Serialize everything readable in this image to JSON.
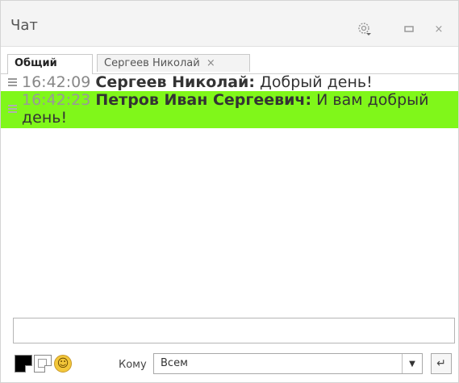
{
  "window": {
    "title": "Чат",
    "icons": {
      "settings": "gear-icon",
      "minimize": "minimize-icon",
      "close": "close-icon"
    }
  },
  "tabs": [
    {
      "label": "Общий",
      "active": true
    },
    {
      "label": "Сергеев Николай",
      "active": false,
      "close": "×"
    }
  ],
  "messages": [
    {
      "time": "16:42:09",
      "author": "Сергеев Николай:",
      "text": "Добрый день!",
      "highlighted": false
    },
    {
      "time": "16:42:23",
      "author": "Петров Иван  Сергеевич:",
      "text": "И вам добрый день!",
      "highlighted": true,
      "highlight_color": "#80f71a"
    }
  ],
  "composer": {
    "input_value": "",
    "to_label": "Кому",
    "recipient": "Всем",
    "tools": [
      "text-color-icon",
      "background-color-icon",
      "smiley-icon"
    ],
    "send_icon": "enter-icon"
  }
}
